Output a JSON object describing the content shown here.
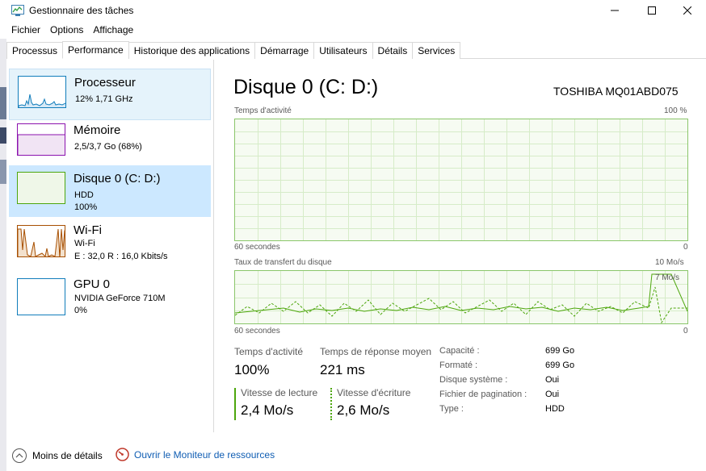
{
  "window": {
    "title": "Gestionnaire des tâches"
  },
  "menu": [
    "Fichier",
    "Options",
    "Affichage"
  ],
  "tabs": [
    "Processus",
    "Performance",
    "Historique des applications",
    "Démarrage",
    "Utilisateurs",
    "Détails",
    "Services"
  ],
  "active_tab": "Performance",
  "resources": [
    {
      "name": "Processeur",
      "line1": "12%  1,71 GHz",
      "line2": ""
    },
    {
      "name": "Mémoire",
      "line1": "2,5/3,7 Go (68%)",
      "line2": ""
    },
    {
      "name": "Disque 0 (C: D:)",
      "line1": "HDD",
      "line2": "100%"
    },
    {
      "name": "Wi-Fi",
      "line1": "Wi-Fi",
      "line2": "E : 32,0  R : 16,0 Kbits/s"
    },
    {
      "name": "GPU 0",
      "line1": "NVIDIA GeForce 710M",
      "line2": "0%"
    }
  ],
  "disk": {
    "title": "Disque 0 (C: D:)",
    "model": "TOSHIBA MQ01ABD075",
    "activity_chart": {
      "label": "Temps d'activité",
      "max_label": "100 %",
      "time_label": "60 secondes",
      "min_label": "0"
    },
    "transfer_chart": {
      "label": "Taux de transfert du disque",
      "max_label": "10 Mo/s",
      "secondary_max": "7 Mo/s",
      "time_label": "60 secondes",
      "min_label": "0"
    },
    "stats": {
      "active_time_label": "Temps d'activité",
      "active_time_value": "100%",
      "response_label": "Temps de réponse moyen",
      "response_value": "221 ms",
      "read_label": "Vitesse de lecture",
      "read_value": "2,4 Mo/s",
      "write_label": "Vitesse d'écriture",
      "write_value": "2,6 Mo/s"
    },
    "properties": [
      {
        "label": "Capacité :",
        "value": "699 Go"
      },
      {
        "label": "Formaté :",
        "value": "699 Go"
      },
      {
        "label": "Disque système :",
        "value": "Oui"
      },
      {
        "label": "Fichier de pagination :",
        "value": "Oui"
      },
      {
        "label": "Type :",
        "value": "HDD"
      }
    ]
  },
  "footer": {
    "less_details": "Moins de détails",
    "resource_monitor": "Ouvrir le Moniteur de ressources"
  },
  "colors": {
    "selected": "#cce8ff",
    "hover": "#e5f3fb",
    "disk_border": "#8ac66a",
    "disk_fill": "#f6fbf2",
    "cpu": "#117dbb",
    "memory": "#8b12ae",
    "wifi": "#a74f01",
    "link": "#0f5db3"
  }
}
